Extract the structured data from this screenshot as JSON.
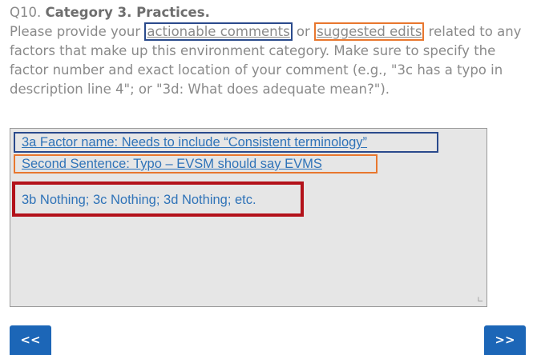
{
  "question": {
    "number": "Q10.",
    "title": "Category 3. Practices.",
    "prompt_before": "Please provide your ",
    "highlight_1": "actionable comments",
    "prompt_or": " or ",
    "highlight_2": "suggested edits",
    "prompt_after": " related to any factors that make up this environment category. Make sure to specify the factor number and exact location of your comment (e.g., \"3c has a typo in description line 4\"; or \"3d: What does adequate mean?\")."
  },
  "response": {
    "line_1": "3a Factor name: Needs to include “Consistent terminology”",
    "line_2": "Second Sentence: Typo – EVSM should say EVMS",
    "line_3": "3b Nothing; 3c Nothing; 3d Nothing; etc."
  },
  "navigation": {
    "prev_label": "<<",
    "next_label": ">>"
  },
  "colors": {
    "annotation_blue": "#2a4a8c",
    "annotation_orange": "#e8772e",
    "annotation_red": "#b3121a",
    "button_blue": "#1c66b7",
    "link_text": "#2f73b8"
  },
  "icons": {
    "resize_grip": "resize-grip-icon"
  }
}
